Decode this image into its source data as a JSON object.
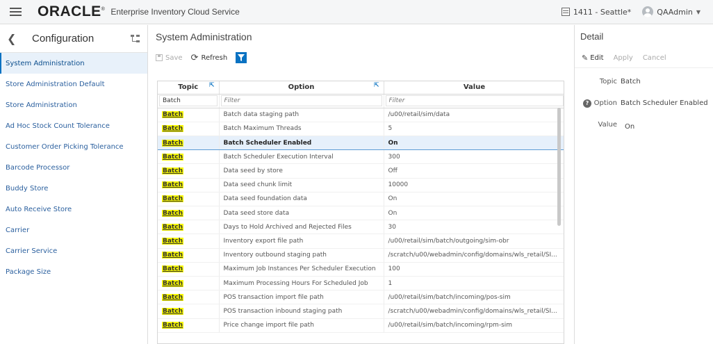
{
  "header": {
    "logo": "ORACLE",
    "logo_mark": "®",
    "app_title": "Enterprise Inventory Cloud Service",
    "store": "1411 - Seattle*",
    "user": "QAAdmin"
  },
  "sidebar": {
    "title": "Configuration",
    "items": [
      "System Administration",
      "Store Administration Default",
      "Store Administration",
      "Ad Hoc Stock Count Tolerance",
      "Customer Order Picking Tolerance",
      "Barcode Processor",
      "Buddy Store",
      "Auto Receive Store",
      "Carrier",
      "Carrier Service",
      "Package Size"
    ]
  },
  "main": {
    "title": "System Administration",
    "toolbar": {
      "save": "Save",
      "refresh": "Refresh"
    },
    "columns": {
      "topic": "Topic",
      "option": "Option",
      "value": "Value"
    },
    "filter": {
      "topic_value": "Batch",
      "option_placeholder": "Filter",
      "value_placeholder": "Filter"
    },
    "rows": [
      {
        "topic": "Batch",
        "option": "Batch data staging path",
        "value": "/u00/retail/sim/data"
      },
      {
        "topic": "Batch",
        "option": "Batch Maximum Threads",
        "value": "5"
      },
      {
        "topic": "Batch",
        "option": "Batch Scheduler Enabled",
        "value": "On"
      },
      {
        "topic": "Batch",
        "option": "Batch Scheduler Execution Interval",
        "value": "300"
      },
      {
        "topic": "Batch",
        "option": "Data seed by store",
        "value": "Off"
      },
      {
        "topic": "Batch",
        "option": "Data seed chunk limit",
        "value": "10000"
      },
      {
        "topic": "Batch",
        "option": "Data seed foundation data",
        "value": "On"
      },
      {
        "topic": "Batch",
        "option": "Data seed store data",
        "value": "On"
      },
      {
        "topic": "Batch",
        "option": "Days to Hold Archived and Rejected Files",
        "value": "30"
      },
      {
        "topic": "Batch",
        "option": "Inventory export file path",
        "value": "/u00/retail/sim/batch/outgoing/sim-obr"
      },
      {
        "topic": "Batch",
        "option": "Inventory outbound staging path",
        "value": "/scratch/u00/webadmin/config/domains/wls_retail/SI..."
      },
      {
        "topic": "Batch",
        "option": "Maximum Job Instances Per Scheduler Execution",
        "value": "100"
      },
      {
        "topic": "Batch",
        "option": "Maximum Processing Hours For Scheduled Job",
        "value": "1"
      },
      {
        "topic": "Batch",
        "option": "POS transaction import file path",
        "value": "/u00/retail/sim/batch/incoming/pos-sim"
      },
      {
        "topic": "Batch",
        "option": "POS transaction inbound staging path",
        "value": "/scratch/u00/webadmin/config/domains/wls_retail/SI..."
      },
      {
        "topic": "Batch",
        "option": "Price change import file path",
        "value": "/u00/retail/sim/batch/incoming/rpm-sim"
      }
    ]
  },
  "detail": {
    "title": "Detail",
    "edit": "Edit",
    "apply": "Apply",
    "cancel": "Cancel",
    "topic_label": "Topic",
    "topic_value": "Batch",
    "option_label": "Option",
    "option_value": "Batch Scheduler Enabled",
    "value_label": "Value",
    "value_value": "On"
  }
}
